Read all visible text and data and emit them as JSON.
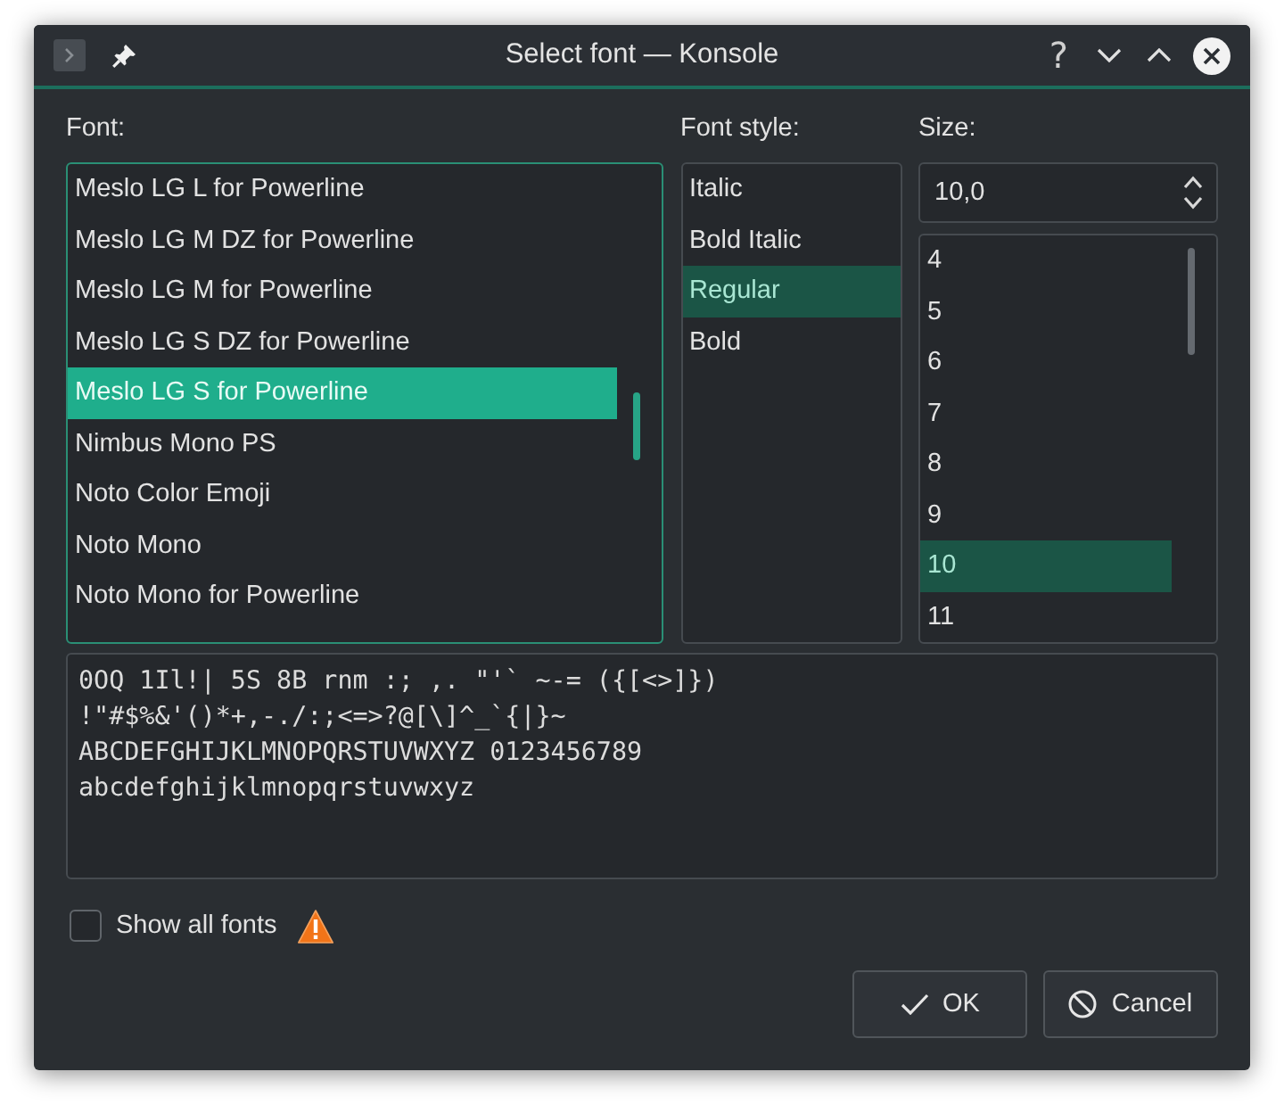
{
  "window": {
    "title": "Select font — Konsole",
    "help_button": "?"
  },
  "font": {
    "label": "Font:",
    "focused": true,
    "items": [
      {
        "label": "Meslo LG L for Powerline",
        "selected": false
      },
      {
        "label": "Meslo LG M DZ for Powerline",
        "selected": false
      },
      {
        "label": "Meslo LG M for Powerline",
        "selected": false
      },
      {
        "label": "Meslo LG S DZ for Powerline",
        "selected": false
      },
      {
        "label": "Meslo LG S for Powerline",
        "selected": true
      },
      {
        "label": "Nimbus Mono PS",
        "selected": false
      },
      {
        "label": "Noto Color Emoji",
        "selected": false
      },
      {
        "label": "Noto Mono",
        "selected": false
      },
      {
        "label": "Noto Mono for Powerline",
        "selected": false
      }
    ]
  },
  "font_style": {
    "label": "Font style:",
    "focused": false,
    "items": [
      {
        "label": "Italic",
        "selected": false
      },
      {
        "label": "Bold Italic",
        "selected": false
      },
      {
        "label": "Regular",
        "selected": true
      },
      {
        "label": "Bold",
        "selected": false
      }
    ]
  },
  "size": {
    "label": "Size:",
    "value": "10,0",
    "focused": false,
    "items": [
      {
        "label": "4",
        "selected": false
      },
      {
        "label": "5",
        "selected": false
      },
      {
        "label": "6",
        "selected": false
      },
      {
        "label": "7",
        "selected": false
      },
      {
        "label": "8",
        "selected": false
      },
      {
        "label": "9",
        "selected": false
      },
      {
        "label": "10",
        "selected": true
      },
      {
        "label": "11",
        "selected": false
      }
    ]
  },
  "preview": {
    "lines": [
      "0OQ 1Il!| 5S 8B rnm :; ,. \"'` ~-= ({[<>]})",
      "!\"#$%&'()*+,-./:;<=>?@[\\]^_`{|}~",
      "ABCDEFGHIJKLMNOPQRSTUVWXYZ 0123456789",
      "abcdefghijklmnopqrstuvwxyz"
    ]
  },
  "show_all_fonts": {
    "label": "Show all fonts",
    "checked": false
  },
  "buttons": [
    {
      "kind": "ok",
      "label": "OK"
    },
    {
      "kind": "cancel",
      "label": "Cancel"
    }
  ]
}
